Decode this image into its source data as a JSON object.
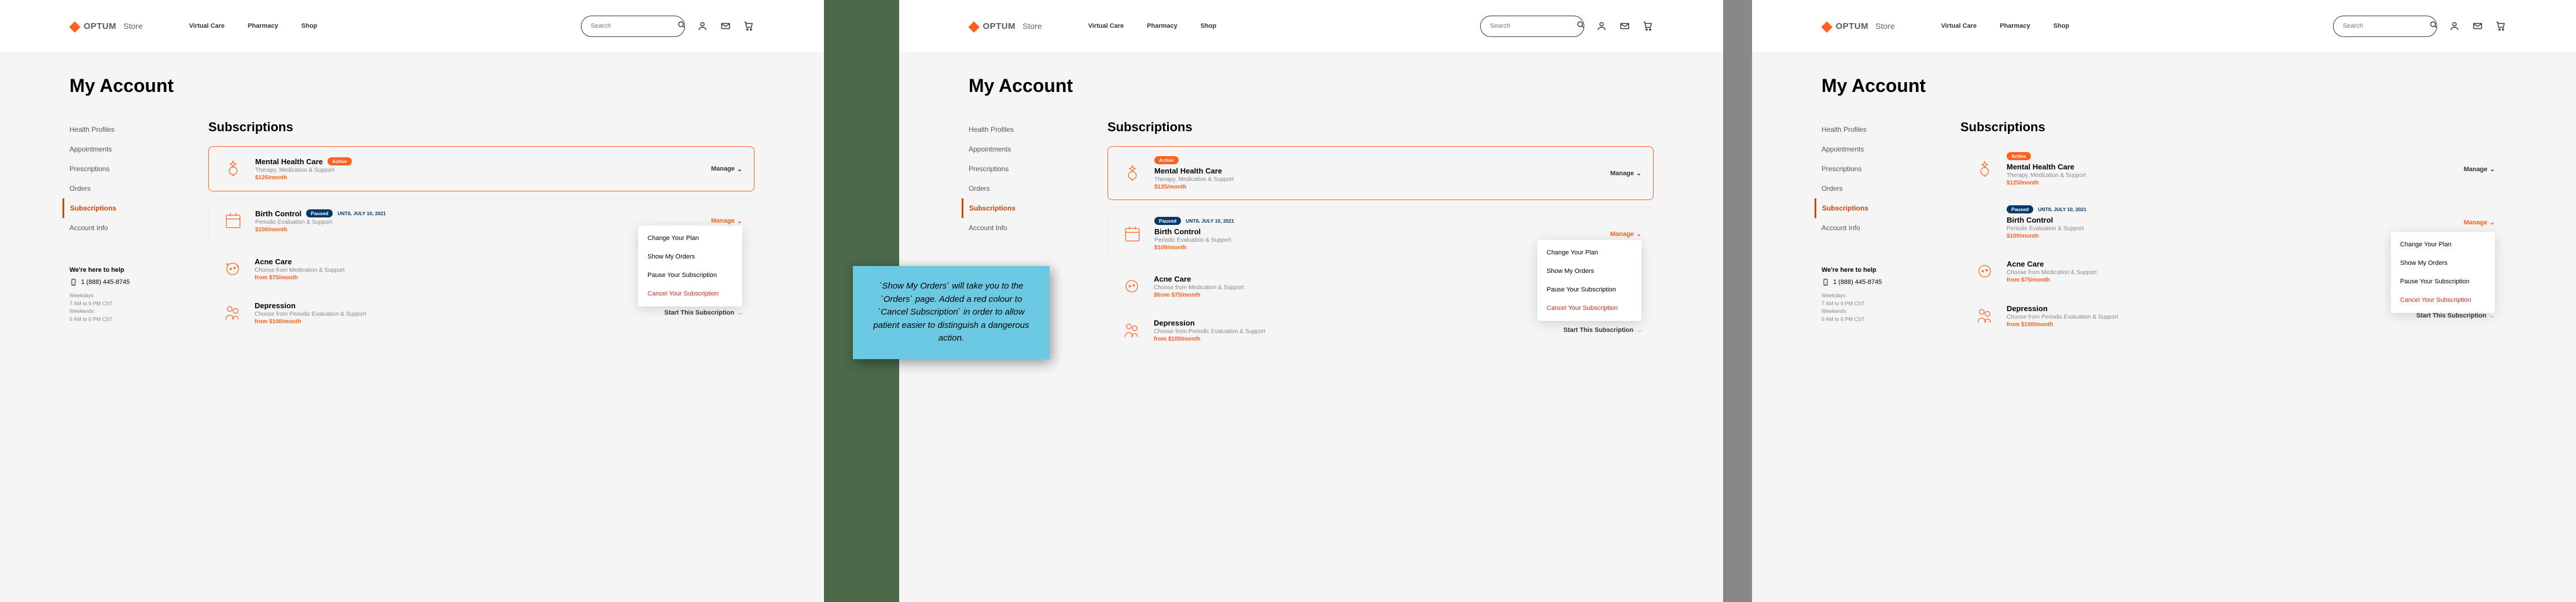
{
  "logo": {
    "text": "OPTUM",
    "store": "Store"
  },
  "nav": {
    "virtual": "Virtual Care",
    "pharmacy": "Pharmacy",
    "shop": "Shop"
  },
  "search": {
    "placeholder": "Search"
  },
  "pageTitle": "My Account",
  "sidebar": {
    "items": [
      "Health Profiles",
      "Appointments",
      "Prescriptions",
      "Orders",
      "Subscriptions",
      "Account Info"
    ],
    "active": "Subscriptions"
  },
  "help": {
    "title": "We're here to help",
    "phone": "1 (888) 445-8745",
    "hours": {
      "weekdayLabel": "Weekdays",
      "weekday": "7 AM to 9 PM CST",
      "weekendLabel": "Weekends",
      "weekend": "9 AM to 6 PM CST"
    }
  },
  "sectionTitle": "Subscriptions",
  "manage": "Manage",
  "startLink": "Start This Subscription",
  "subs": {
    "mental": {
      "name": "Mental Health Care",
      "desc": "Therapy, Medication & Support",
      "price": "$125/month",
      "status": "Active"
    },
    "birth": {
      "name": "Birth Control",
      "desc": "Periodic Evaluation & Support",
      "price": "$100/month",
      "status": "Paused",
      "until": "UNTIL JULY 10, 2021"
    },
    "acne1": {
      "name": "Acne Care",
      "desc": "Choose from Medication & Support",
      "price": "from $75/month"
    },
    "acne2": {
      "name": "Acne Care",
      "desc": "Choose from Medication & Support",
      "price": "$from $75/month"
    },
    "dep": {
      "name": "Depression",
      "desc": "Choose from Periodic Evaluation & Support",
      "price": "from $100/month"
    }
  },
  "dropdown": {
    "changePlan": "Change Your Plan",
    "showOrders": "Show My Orders",
    "pause": "Pause Your Subscription",
    "cancel": "Cancel Your Subscription"
  },
  "callout": "`Show My Orders` will take you to the `Orders` page. Added a red colour to `Cancel Subscription` in order to allow patient easier to distinguish a dangerous action."
}
